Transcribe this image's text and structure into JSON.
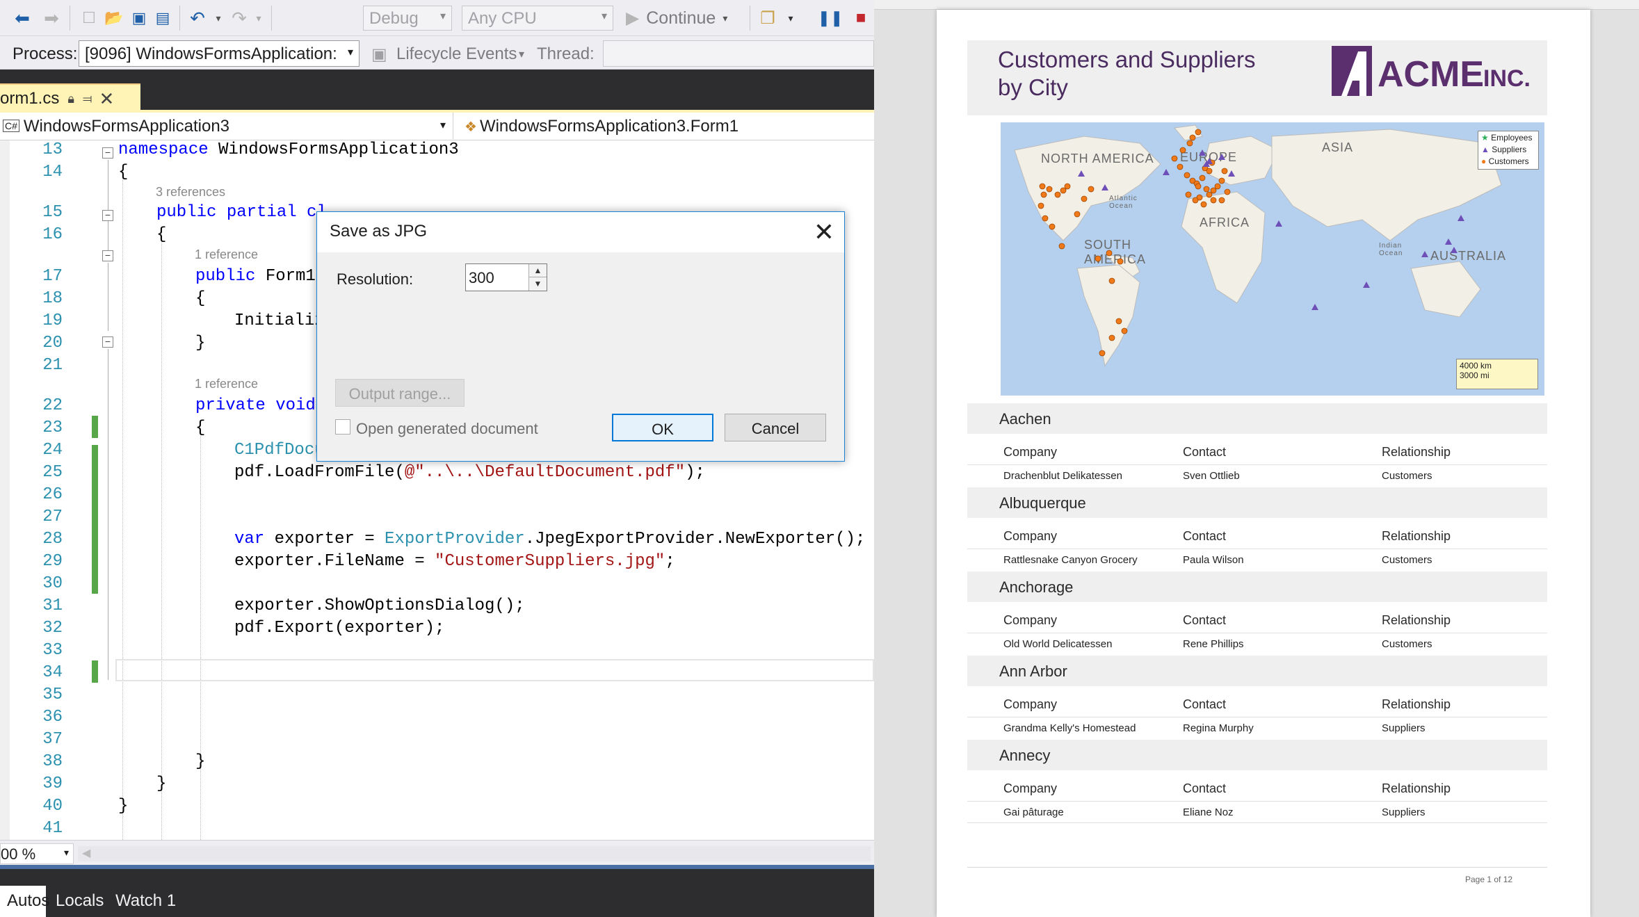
{
  "toolbar": {
    "config": "Debug",
    "platform": "Any CPU",
    "continue_label": "Continue"
  },
  "debug_location": {
    "process_label": "Process:",
    "process_value": "[9096] WindowsFormsApplication:",
    "lifecycle_label": "Lifecycle Events",
    "thread_label": "Thread:"
  },
  "document_tab": {
    "name": "orm1.cs"
  },
  "navbar": {
    "project": "WindowsFormsApplication3",
    "class": "WindowsFormsApplication3.Form1"
  },
  "editor": {
    "line_numbers": [
      "13",
      "14",
      "15",
      "16",
      "17",
      "18",
      "19",
      "20",
      "21",
      "22",
      "23",
      "24",
      "25",
      "26",
      "27",
      "28",
      "29",
      "30",
      "31",
      "32",
      "33",
      "34",
      "35",
      "36",
      "37",
      "38",
      "39",
      "40",
      "41"
    ],
    "refs": [
      "3 references",
      "1 reference",
      "1 reference"
    ],
    "code": {
      "l13_kw": "namespace",
      "l13_rest": " WindowsFormsApplication3",
      "brace_open": "{",
      "brace_close": "}",
      "l15_kw": "public partial cl",
      "l17_kw": "public",
      "l17_rest": " Form1(",
      "l19": "Initializ",
      "l22_kw": "private void",
      "l24_type": "C1PdfDocu",
      "l25_a": "pdf.LoadFromFile(",
      "l25_str": "@\"..\\..\\DefaultDocument.pdf\"",
      "l25_b": ");",
      "l28_kw": "var",
      "l28_a": " exporter = ",
      "l28_type": "ExportProvider",
      "l28_b": ".JpegExportProvider.NewExporter();",
      "l29_a": "exporter.FileName = ",
      "l29_str": "\"CustomerSuppliers.jpg\"",
      "l29_b": ";",
      "l31": "exporter.ShowOptionsDialog();",
      "l32": "pdf.Export(exporter);"
    }
  },
  "zoom": "00 %",
  "bottom_tabs": [
    "Autos",
    "Locals",
    "Watch 1"
  ],
  "dialog": {
    "title": "Save as JPG",
    "resolution_label": "Resolution:",
    "resolution_value": "300",
    "output_range_label": "Output range...",
    "open_doc_label": "Open generated document",
    "ok_label": "OK",
    "cancel_label": "Cancel"
  },
  "pdf": {
    "title_line1": "Customers and Suppliers",
    "title_line2": "by City",
    "logo_text": "ACME",
    "logo_suffix": "INC.",
    "map": {
      "labels": [
        "NORTH AMERICA",
        "EUROPE",
        "ASIA",
        "AFRICA",
        "SOUTH AMERICA",
        "AUSTRALIA",
        "Atlantic Ocean",
        "Indian Ocean"
      ],
      "legend": [
        "Employees",
        "Suppliers",
        "Customers"
      ],
      "scale": [
        "4000 km",
        "3000 mi"
      ],
      "colors": {
        "water": "#b4d0ee",
        "land": "#f2efe6",
        "customers": "#f07a1a",
        "suppliers": "#6e4fb8",
        "employees": "#2fae5a"
      }
    },
    "columns": [
      "Company",
      "Contact",
      "Relationship"
    ],
    "cities": [
      {
        "name": "Aachen",
        "company": "Drachenblut Delikatessen",
        "contact": "Sven Ottlieb",
        "relationship": "Customers"
      },
      {
        "name": "Albuquerque",
        "company": "Rattlesnake Canyon Grocery",
        "contact": "Paula Wilson",
        "relationship": "Customers"
      },
      {
        "name": "Anchorage",
        "company": "Old World Delicatessen",
        "contact": "Rene Phillips",
        "relationship": "Customers"
      },
      {
        "name": "Ann Arbor",
        "company": "Grandma Kelly's Homestead",
        "contact": "Regina Murphy",
        "relationship": "Suppliers"
      },
      {
        "name": "Annecy",
        "company": "Gai pâturage",
        "contact": "Eliane Noz",
        "relationship": "Suppliers"
      }
    ],
    "page_label": "Page 1 of 12"
  }
}
